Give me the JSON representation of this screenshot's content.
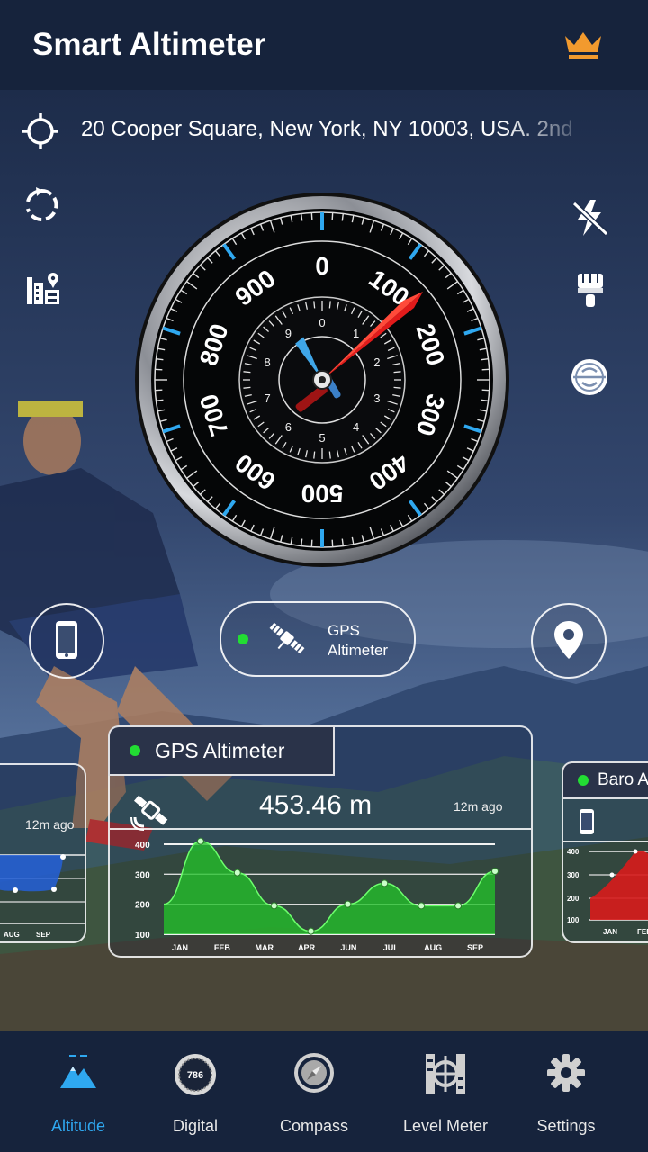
{
  "header": {
    "title": "Smart Altimeter",
    "crown_color": "#f29a2e"
  },
  "location": {
    "address": "20 Cooper Square, New York, NY 10003, USA. 2nd"
  },
  "left_icons": [
    "refresh-icon",
    "map-building-icon"
  ],
  "right_icons": [
    "flash-off-icon",
    "brush-icon",
    "level-icon"
  ],
  "gauge": {
    "outer_labels": [
      "0",
      "100",
      "200",
      "300",
      "400",
      "500",
      "600",
      "700",
      "800",
      "900"
    ],
    "inner_labels": [
      "0",
      "1",
      "2",
      "3",
      "4",
      "5",
      "6",
      "7",
      "8",
      "9"
    ],
    "accent": "#2fa8f0",
    "needle_color": "#e21b1b"
  },
  "mode_switch": {
    "label_line1": "GPS",
    "label_line2": "Altimeter",
    "status_color": "#22dd33"
  },
  "gps_card": {
    "title": "GPS Altimeter",
    "value": "453.46 m",
    "updated": "12m ago",
    "y_ticks": [
      "400",
      "300",
      "200",
      "100"
    ],
    "x_ticks": [
      "JAN",
      "FEB",
      "MAR",
      "APR",
      "JUN",
      "JUL",
      "AUG",
      "SEP"
    ],
    "series_color": "#22c22a"
  },
  "left_card": {
    "updated": "12m ago",
    "x_ticks": [
      "AUG",
      "SEP"
    ]
  },
  "baro_card": {
    "title": "Baro A",
    "y_ticks": [
      "400",
      "300",
      "200",
      "100"
    ],
    "x_ticks": [
      "JAN",
      "FEB"
    ],
    "series_color": "#d81b1b"
  },
  "chart_data": {
    "type": "area",
    "categories": [
      "JAN",
      "FEB",
      "MAR",
      "APR",
      "JUN",
      "JUL",
      "AUG",
      "SEP"
    ],
    "series": [
      {
        "values": [
          200,
          410,
          305,
          195,
          110,
          200,
          270,
          195,
          195,
          310
        ]
      }
    ],
    "x": [
      "JAN",
      "JAN-FEB",
      "FEB",
      "MAR",
      "MAR-APR",
      "APR",
      "JUN",
      "JUL",
      "AUG",
      "SEP"
    ],
    "ylim": [
      100,
      400
    ],
    "grid": true
  },
  "bottom_nav": {
    "items": [
      {
        "label": "Altitude",
        "icon": "mountain-icon",
        "active": true
      },
      {
        "label": "Digital",
        "icon": "digital-dial-icon",
        "active": false
      },
      {
        "label": "Compass",
        "icon": "compass-icon",
        "active": false
      },
      {
        "label": "Level Meter",
        "icon": "level-meter-icon",
        "active": false
      },
      {
        "label": "Settings",
        "icon": "gear-icon",
        "active": false
      }
    ],
    "digital_badge": "786",
    "active_color": "#2fa8f0"
  }
}
